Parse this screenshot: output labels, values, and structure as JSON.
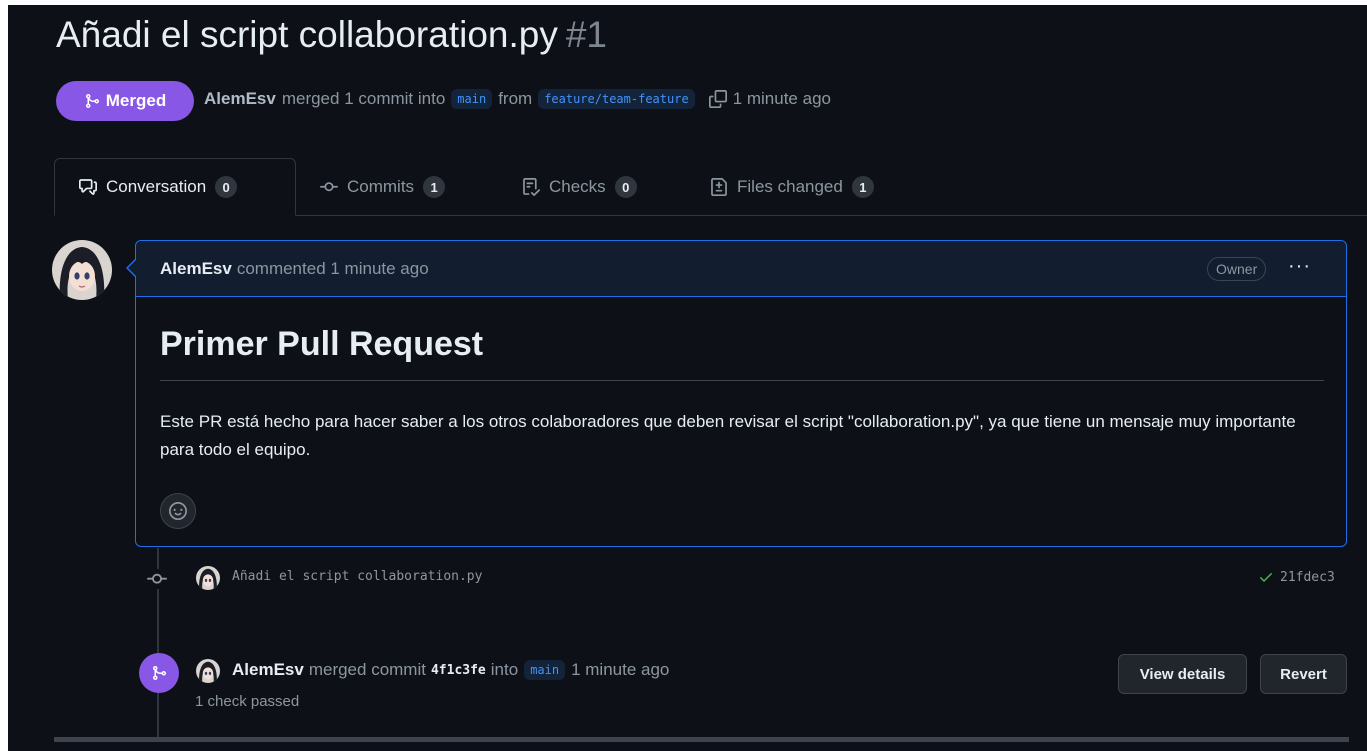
{
  "pr": {
    "title": "Añadi el script collaboration.py",
    "number": "#1",
    "state": "Merged",
    "author": "AlemEsv",
    "merged_text": "merged 1 commit into",
    "base_branch": "main",
    "from_text": "from",
    "head_branch": "feature/team-feature",
    "time": "1 minute ago"
  },
  "tabs": [
    {
      "label": "Conversation",
      "count": "0",
      "icon": "comment-discussion-icon"
    },
    {
      "label": "Commits",
      "count": "1",
      "icon": "git-commit-icon"
    },
    {
      "label": "Checks",
      "count": "0",
      "icon": "checklist-icon"
    },
    {
      "label": "Files changed",
      "count": "1",
      "icon": "file-diff-icon"
    }
  ],
  "comment": {
    "author": "AlemEsv",
    "action": "commented 1 minute ago",
    "role_badge": "Owner",
    "menu": "···",
    "heading": "Primer Pull Request",
    "body": "Este PR está hecho para hacer saber a los otros colaboradores que deben revisar el script \"collaboration.py\", ya que tiene un mensaje muy importante para todo el equipo."
  },
  "commit": {
    "message": "Añadi el script collaboration.py",
    "sha": "21fdec3",
    "status_color": "#3fb950"
  },
  "merge_event": {
    "author": "AlemEsv",
    "text_before": "merged commit",
    "sha": "4f1c3fe",
    "text_into": "into",
    "branch": "main",
    "time": "1 minute ago",
    "checks": "1 check passed",
    "view_details": "View details",
    "revert": "Revert"
  },
  "colors": {
    "background": "#0d1117",
    "merged": "#8957e5",
    "accent_blue": "#1f6feb",
    "muted": "#8d96a0"
  }
}
